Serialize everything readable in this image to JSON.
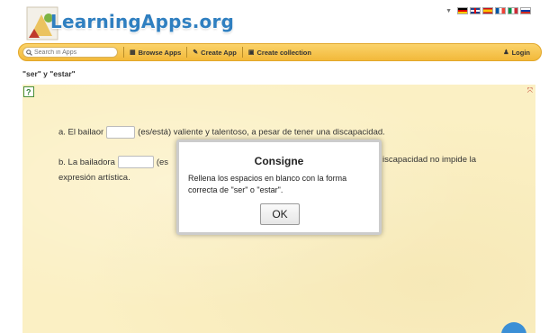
{
  "header": {
    "logo_text": "LearningApps.org",
    "languages": [
      "de",
      "gb",
      "es",
      "fr",
      "it",
      "ru"
    ]
  },
  "nav": {
    "search_placeholder": "Search in Apps",
    "browse_label": "Browse Apps",
    "create_label": "Create App",
    "collection_label": "Create collection",
    "login_label": "Login",
    "bar_color": "#f6c54d"
  },
  "page": {
    "title": "\"ser\" y \"estar\""
  },
  "exercise": {
    "sentence_a_prefix": "a. El bailaor",
    "sentence_a_suffix": "(es/está) valiente y talentoso, a pesar de tener una discapacidad.",
    "sentence_b_prefix": "b. La bailadora",
    "sentence_b_partial": "(es",
    "sentence_b_tail": "iscapacidad no impide la",
    "sentence_b_line2": "expresión artística.",
    "background_color": "#fbf0c4"
  },
  "modal": {
    "title": "Consigne",
    "text": "Rellena los espacios en blanco con la forma correcta de \"ser\" o \"estar\".",
    "ok_label": "OK"
  }
}
